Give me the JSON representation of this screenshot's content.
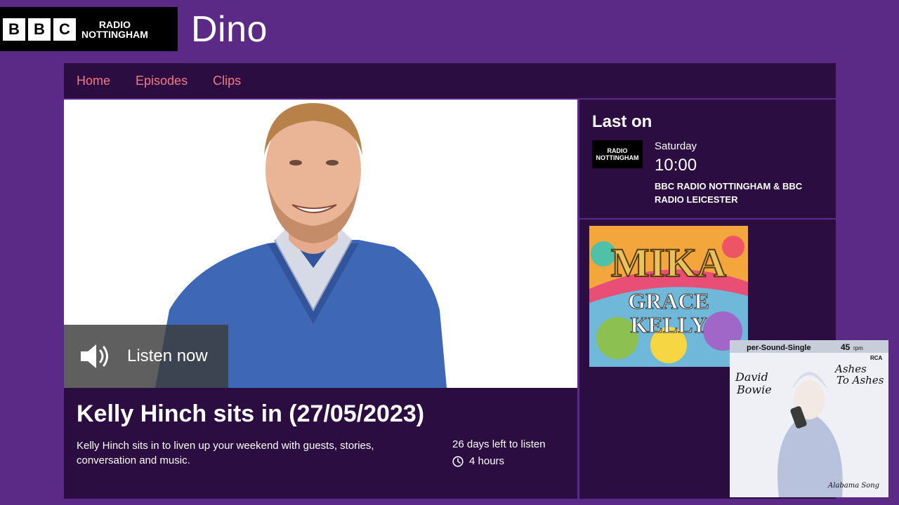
{
  "brand": {
    "bbc_letters": [
      "B",
      "B",
      "C"
    ],
    "station_line1": "RADIO",
    "station_line2": "NOTTINGHAM"
  },
  "show": {
    "title": "Dino"
  },
  "nav": {
    "items": [
      "Home",
      "Episodes",
      "Clips"
    ]
  },
  "hero": {
    "listen_label": "Listen now"
  },
  "episode": {
    "title": "Kelly Hinch sits in (27/05/2023)",
    "description": "Kelly Hinch sits in to liven up your weekend with guests, stories, conversation and music.",
    "availability": "26 days left to listen",
    "duration": "4 hours"
  },
  "last_on": {
    "heading": "Last on",
    "logo_line1": "RADIO",
    "logo_line2": "NOTTINGHAM",
    "day": "Saturday",
    "time": "10:00",
    "network": "BBC RADIO NOTTINGHAM & BBC RADIO LEICESTER"
  },
  "albums": [
    {
      "artist": "MIKA",
      "title_line1": "GRACE",
      "title_line2": "KELLY"
    },
    {
      "header": "per-Sound-Single",
      "rpm": "45",
      "rpm_unit": "rpm",
      "artist_line1": "David",
      "artist_line2": "Bowie",
      "title_line1": "Ashes",
      "title_line2": "To Ashes",
      "b_side": "Alabama Song",
      "label": "RCA"
    }
  ],
  "colors": {
    "page_bg": "#5b2a86",
    "panel_bg": "#2b0d42",
    "nav_link": "#f57a82"
  }
}
